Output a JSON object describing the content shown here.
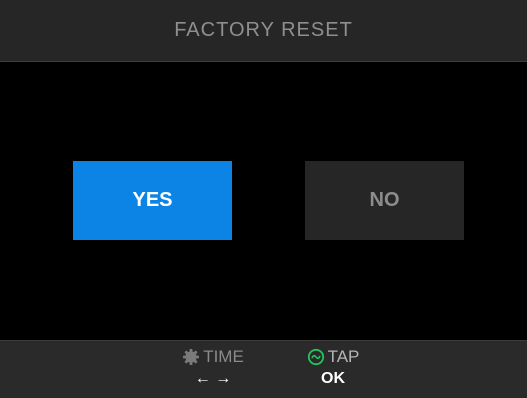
{
  "header": {
    "title": "FACTORY RESET"
  },
  "dialog": {
    "yes_label": "YES",
    "no_label": "NO",
    "selected": "YES"
  },
  "footer": {
    "time_hint": {
      "icon": "gear-icon",
      "label": "TIME",
      "action": "← →"
    },
    "tap_hint": {
      "icon": "tap-circle-icon",
      "label": "TAP",
      "action": "OK"
    }
  },
  "colors": {
    "accent": "#0b84e6",
    "tap_icon": "#22c55e",
    "header_bg": "#262626",
    "footer_bg": "#2a2a2a"
  }
}
